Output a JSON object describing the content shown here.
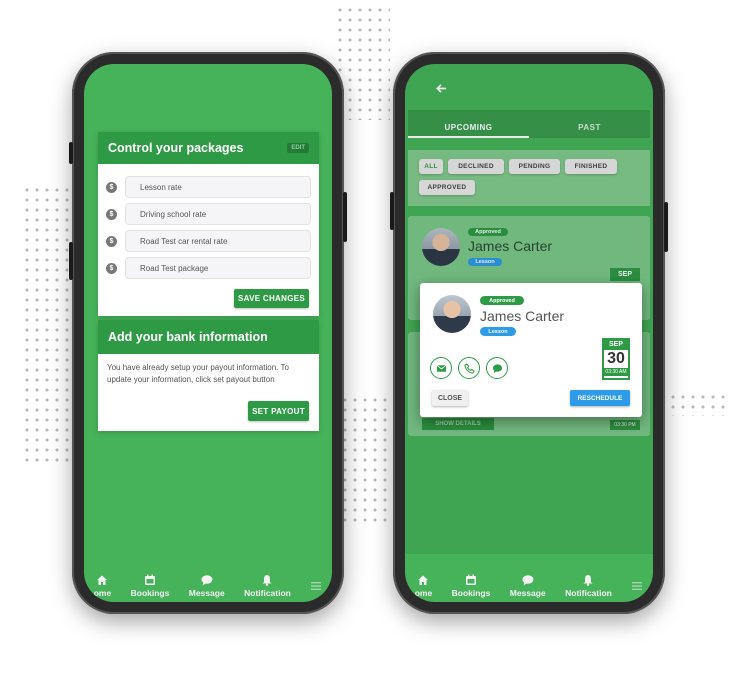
{
  "left_phone": {
    "packages": {
      "title": "Control your packages",
      "edit_tag": "EDIT",
      "fields": [
        {
          "placeholder": "Lesson rate"
        },
        {
          "placeholder": "Driving school rate"
        },
        {
          "placeholder": "Road Test car rental rate"
        },
        {
          "placeholder": "Road Test package"
        }
      ],
      "save_label": "SAVE CHANGES"
    },
    "bank": {
      "title": "Add your bank information",
      "message": "You have already setup your payout information. To update your information, click set payout button",
      "button_label": "SET PAYOUT"
    }
  },
  "right_phone": {
    "tabs": [
      {
        "label": "UPCOMING",
        "active": true
      },
      {
        "label": "PAST",
        "active": false
      }
    ],
    "filters": [
      {
        "label": "ALL",
        "active": true
      },
      {
        "label": "DECLINED",
        "active": false
      },
      {
        "label": "PENDING",
        "active": false
      },
      {
        "label": "FINISHED",
        "active": false
      },
      {
        "label": "APPROVED",
        "active": false
      }
    ],
    "bg_card": {
      "status": "Approved",
      "name": "James Carter",
      "type": "Lesson",
      "month": "SEP"
    },
    "bg_card_2": {
      "button": "SHOW DETAILS",
      "time": "03:30 PM"
    },
    "modal": {
      "status": "Approved",
      "name": "James Carter",
      "type": "Lesson",
      "month": "SEP",
      "day": "30",
      "time": "03:30 AM",
      "close_label": "CLOSE",
      "reschedule_label": "RESCHEDULE"
    }
  },
  "nav": {
    "items": [
      {
        "label": "Home",
        "icon": "home-icon"
      },
      {
        "label": "Bookings",
        "icon": "calendar-icon"
      },
      {
        "label": "Message",
        "icon": "chat-icon"
      },
      {
        "label": "Notification",
        "icon": "bell-icon"
      }
    ],
    "left_visible": {
      "home": "ome",
      "bookings": "Bookings",
      "message": "Message",
      "notification": "Notification"
    }
  },
  "colors": {
    "brand_green": "#46b35a",
    "dark_green": "#2f9a45",
    "accent_blue": "#2d9be6"
  }
}
